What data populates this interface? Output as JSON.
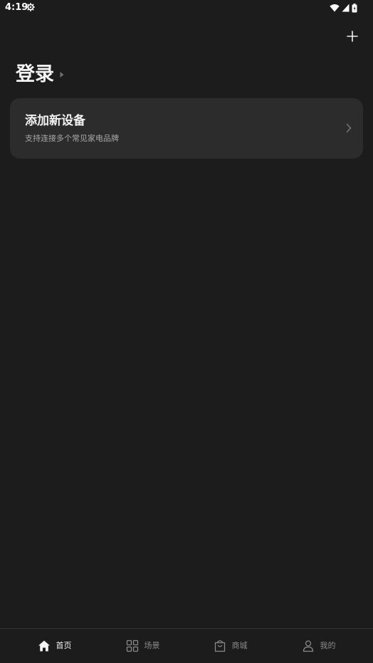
{
  "status_bar": {
    "time": "4:19",
    "icons": [
      "gear-icon",
      "wifi-icon",
      "signal-icon",
      "battery-icon"
    ]
  },
  "header": {
    "add_icon": "plus-icon"
  },
  "login": {
    "label": "登录",
    "arrow_icon": "caret-right-icon"
  },
  "add_device_card": {
    "title": "添加新设备",
    "subtitle": "支持连接多个常见家电品牌",
    "chevron_icon": "chevron-right-icon"
  },
  "tab_bar": {
    "items": [
      {
        "label": "首页",
        "icon": "home-icon",
        "active": true
      },
      {
        "label": "场景",
        "icon": "grid-icon",
        "active": false
      },
      {
        "label": "商城",
        "icon": "shopping-bag-icon",
        "active": false
      },
      {
        "label": "我的",
        "icon": "person-icon",
        "active": false
      }
    ]
  },
  "colors": {
    "background": "#1c1c1c",
    "card": "#2c2c2c",
    "text_primary": "#f2f2f2",
    "text_secondary": "#a9a9a9",
    "tab_inactive": "#8a8a8a"
  }
}
